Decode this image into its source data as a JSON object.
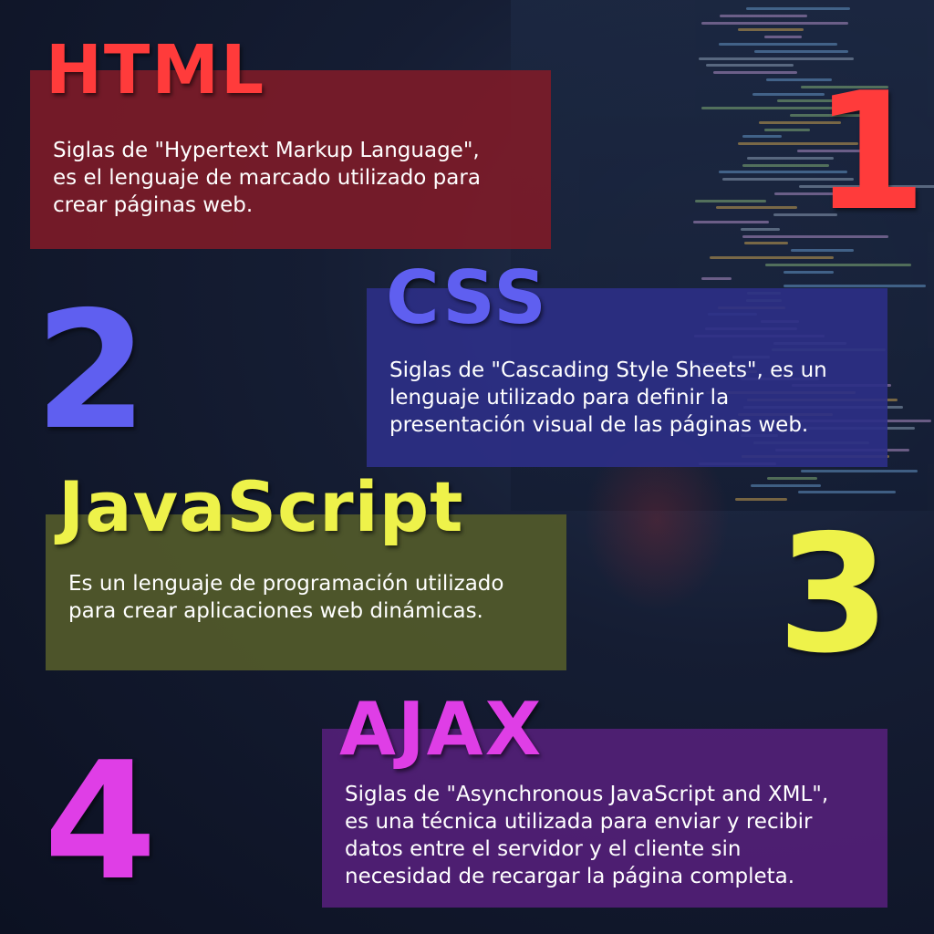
{
  "colors": {
    "html_accent": "#ff3b3b",
    "css_accent": "#5f5ff0",
    "js_accent": "#eef24a",
    "ajax_accent": "#df3ee6",
    "html_box": "#7c1b28",
    "css_box": "#2c2f86",
    "js_box": "#535a2a",
    "ajax_box": "#521f77"
  },
  "items": [
    {
      "number": "1",
      "title": "HTML",
      "description": "Siglas de \"Hypertext Markup Language\",\nes el lenguaje de marcado utilizado para\ncrear páginas web."
    },
    {
      "number": "2",
      "title": "CSS",
      "description": "Siglas de \"Cascading Style Sheets\", es un\nlenguaje utilizado para definir la\npresentación visual de las páginas web."
    },
    {
      "number": "3",
      "title": "JavaScript",
      "description": "Es un lenguaje de programación utilizado\npara crear aplicaciones web dinámicas."
    },
    {
      "number": "4",
      "title": "AJAX",
      "description": "Siglas de \"Asynchronous JavaScript and XML\",\nes una técnica utilizada para enviar y recibir\ndatos entre el servidor y el cliente sin\nnecesidad de recargar la página completa."
    }
  ]
}
